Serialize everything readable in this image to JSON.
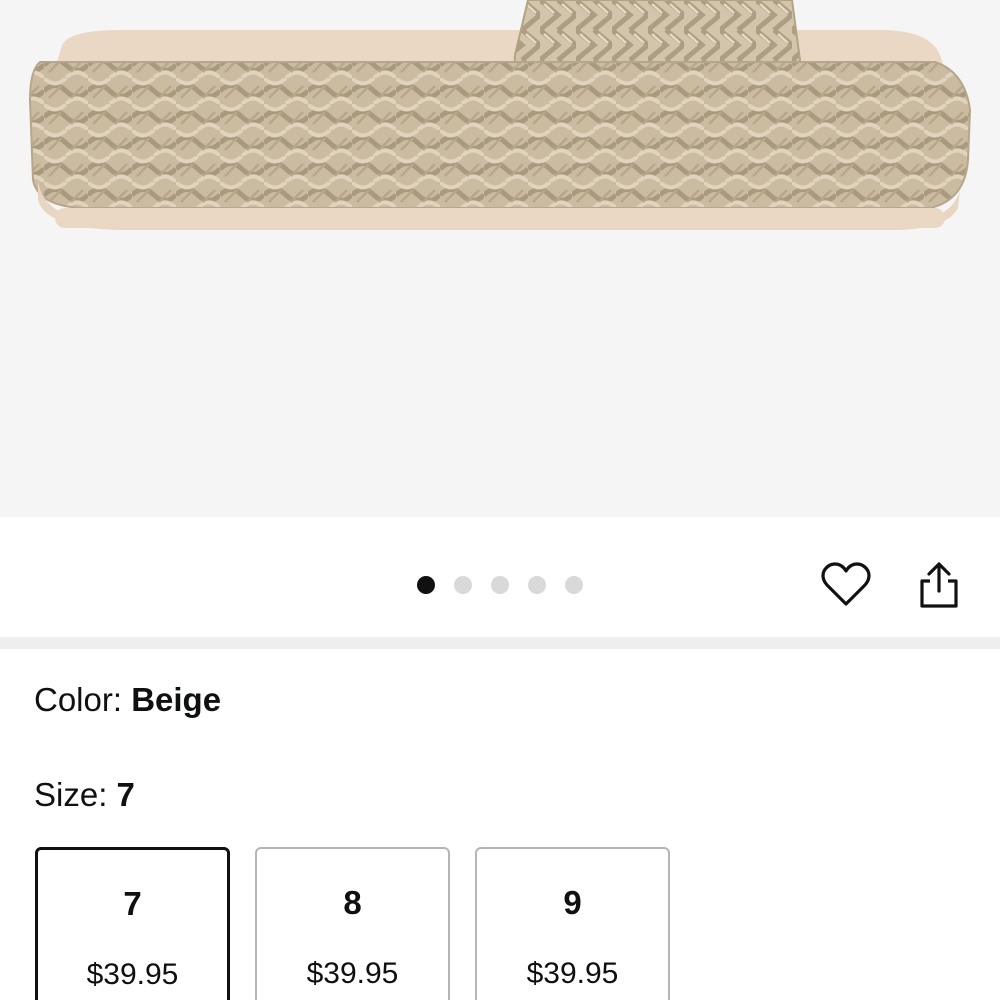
{
  "product_image": {
    "subject": "sandal-image",
    "carousel": {
      "total": 5,
      "active_index": 0
    }
  },
  "actions": {
    "favorite_icon": "heart-icon",
    "share_icon": "share-icon"
  },
  "variation": {
    "color_label": "Color: ",
    "color_value": "Beige",
    "size_label": "Size: ",
    "size_value": "7",
    "sizes": [
      {
        "size": "7",
        "price": "$39.95",
        "selected": true
      },
      {
        "size": "8",
        "price": "$39.95",
        "selected": false
      },
      {
        "size": "9",
        "price": "$39.95",
        "selected": false
      }
    ]
  },
  "colors": {
    "background": "#f5f5f5",
    "text": "#0f1111",
    "dot_active": "#111111",
    "dot_inactive": "#d9d9d9",
    "selected_border": "#111111",
    "option_border": "#b5b5b5",
    "jute": "#cdbfa5",
    "footbed": "#ead8c4"
  }
}
